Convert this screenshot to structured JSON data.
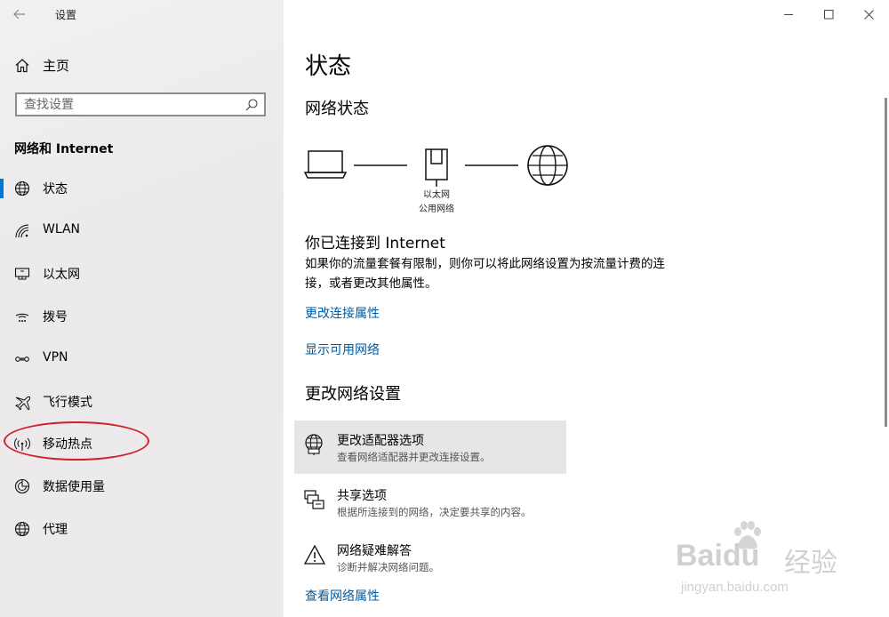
{
  "window": {
    "title": "设置",
    "minimize_glyph": "—",
    "maximize_glyph": "☐",
    "close_glyph": "✕"
  },
  "sidebar": {
    "home_label": "主页",
    "search_placeholder": "查找设置",
    "section_title": "网络和 Internet",
    "items": [
      {
        "label": "状态",
        "icon": "globe-icon",
        "active": true
      },
      {
        "label": "WLAN",
        "icon": "wifi-icon"
      },
      {
        "label": "以太网",
        "icon": "ethernet-icon"
      },
      {
        "label": "拨号",
        "icon": "dialup-icon"
      },
      {
        "label": "VPN",
        "icon": "vpn-icon"
      },
      {
        "label": "飞行模式",
        "icon": "airplane-icon"
      },
      {
        "label": "移动热点",
        "icon": "hotspot-icon"
      },
      {
        "label": "数据使用量",
        "icon": "data-usage-icon"
      },
      {
        "label": "代理",
        "icon": "proxy-globe-icon"
      }
    ]
  },
  "main": {
    "page_title": "状态",
    "network_status_title": "网络状态",
    "diagram": {
      "adapter_label": "以太网",
      "network_type": "公用网络"
    },
    "connected_title": "你已连接到 Internet",
    "connected_desc": "如果你的流量套餐有限制，则你可以将此网络设置为按流量计费的连接，或者更改其他属性。",
    "link_change_props": "更改连接属性",
    "link_show_networks": "显示可用网络",
    "change_settings_title": "更改网络设置",
    "options": [
      {
        "title": "更改适配器选项",
        "desc": "查看网络适配器并更改连接设置。",
        "icon": "adapter-globe-icon"
      },
      {
        "title": "共享选项",
        "desc": "根据所连接到的网络，决定要共享的内容。",
        "icon": "sharing-icon"
      },
      {
        "title": "网络疑难解答",
        "desc": "诊断并解决网络问题。",
        "icon": "warning-icon"
      }
    ],
    "link_view_props": "查看网络属性"
  },
  "watermark": {
    "brand": "Baidu",
    "brand_cn": "经验",
    "url": "jingyan.baidu.com"
  },
  "colors": {
    "accent": "#0078d7",
    "link": "#005a9e",
    "annotation_ring": "#d0202c"
  }
}
